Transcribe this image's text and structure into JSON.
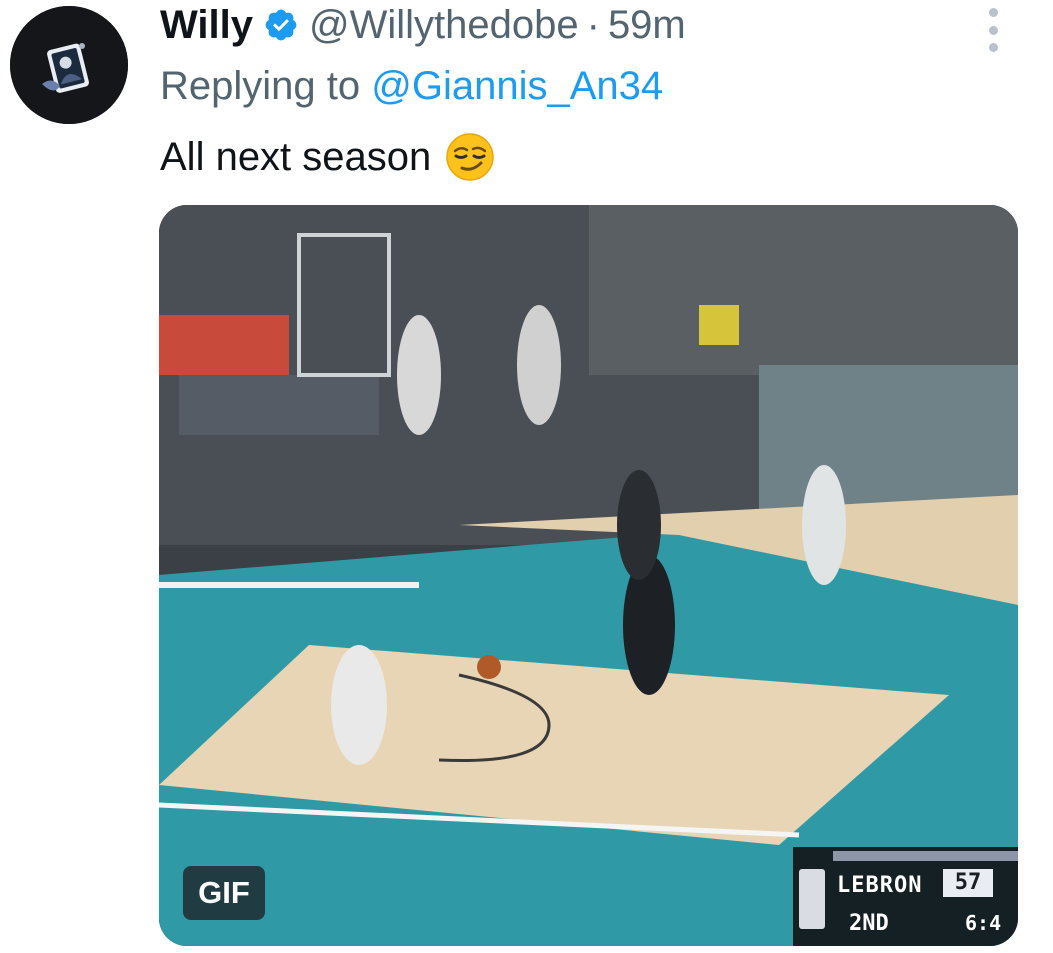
{
  "tweet": {
    "author_name": "Willy",
    "handle": "@Willythedobe",
    "separator": "·",
    "time_ago": "59m",
    "replying_prefix": "Replying to ",
    "replying_to": "@Giannis_An34",
    "text": "All next season",
    "emoji": "smirking-face",
    "verified": true
  },
  "media": {
    "badge": "GIF",
    "scorebug": {
      "team": "LEBRON",
      "score": "57",
      "period": "2ND",
      "clock": "6:4"
    }
  },
  "colors": {
    "accent": "#1d9bf0",
    "text_primary": "#0f1419",
    "text_secondary": "#536471",
    "court_teal": "#2f9aa6",
    "court_wood": "#e8d5b5"
  },
  "icons": {
    "verified": "verified-badge-icon",
    "more": "more-options-icon",
    "emoji": "smirking-face-emoji"
  }
}
